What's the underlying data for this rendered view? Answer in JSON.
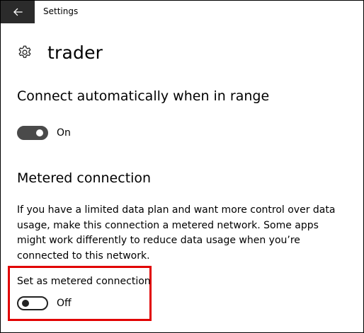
{
  "window": {
    "title": "Settings"
  },
  "titlebar": {
    "back_icon": "back-arrow-icon",
    "back_bg": "#2b2b2b"
  },
  "header": {
    "icon": "gear-icon",
    "network_name": "trader"
  },
  "auto_connect": {
    "heading": "Connect automatically when in range",
    "toggle_state": "On",
    "enabled": true
  },
  "metered": {
    "heading": "Metered connection",
    "description": "If you have a limited data plan and want more control over data usage, make this connection a metered network. Some apps might work differently to reduce data usage when you’re connected to this network.",
    "toggle_label": "Set as metered connection",
    "toggle_state": "Off",
    "enabled": false,
    "highlight_color": "#e10000"
  }
}
